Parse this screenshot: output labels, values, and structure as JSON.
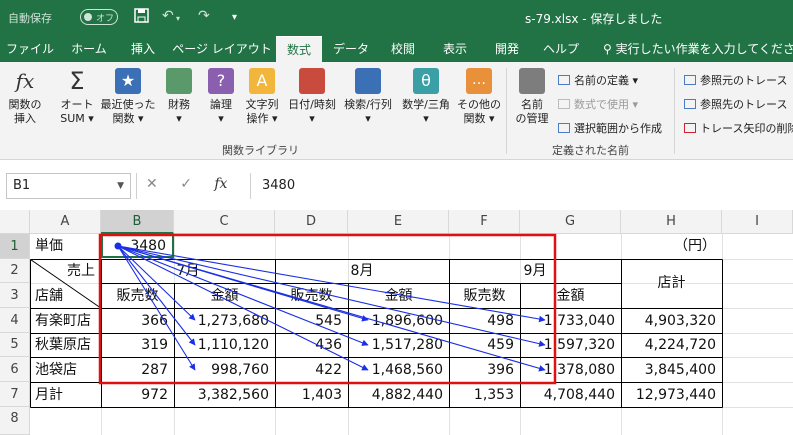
{
  "app": {
    "autosave_label": "自動保存",
    "autosave_state": "オフ",
    "title": "s-79.xlsx - 保存しました",
    "tell_me": "実行したい作業を入力してください"
  },
  "tabs": [
    "ファイル",
    "ホーム",
    "挿入",
    "ページ レイアウト",
    "数式",
    "データ",
    "校閲",
    "表示",
    "開発",
    "ヘルプ"
  ],
  "active_tab": "数式",
  "ribbon": {
    "insert_function": [
      "関数の",
      "挿入"
    ],
    "autosum": [
      "オート",
      "SUM ▾"
    ],
    "recent": [
      "最近使った",
      "関数 ▾"
    ],
    "financial": [
      "財務",
      "▾"
    ],
    "logical": [
      "論理",
      "▾"
    ],
    "text": [
      "文字列",
      "操作 ▾"
    ],
    "datetime": [
      "日付/時刻",
      "▾"
    ],
    "lookup": [
      "検索/行列",
      "▾"
    ],
    "math": [
      "数学/三角",
      "▾"
    ],
    "more": [
      "その他の",
      "関数 ▾"
    ],
    "group_library": "関数ライブラリ",
    "name_manager": [
      "名前",
      "の管理"
    ],
    "define_name": "名前の定義 ▾",
    "use_in_formula": "数式で使用 ▾",
    "create_from_selection": "選択範囲から作成",
    "group_defined": "定義された名前",
    "trace_precedents": "参照元のトレース",
    "trace_dependents": "参照先のトレース",
    "remove_arrows": "トレース矢印の削除 ▾"
  },
  "formula_bar": {
    "name_box": "B1",
    "value": "3480",
    "fx": "fx"
  },
  "columns": [
    "A",
    "B",
    "C",
    "D",
    "E",
    "F",
    "G",
    "H",
    "I"
  ],
  "rows": [
    "1",
    "2",
    "3",
    "4",
    "5",
    "6",
    "7",
    "8"
  ],
  "sheet": {
    "unit_label": "単価",
    "unit_price": "3480",
    "yen_note": "（円）",
    "diag_top": "売上",
    "diag_bottom": "店舗",
    "month_7": "7月",
    "month_8": "8月",
    "month_9": "9月",
    "total_label": "店計",
    "sub_headers": [
      "販売数",
      "金額",
      "販売数",
      "金額",
      "販売数",
      "金額"
    ],
    "data_rows": [
      [
        "有楽町店",
        "366",
        "1,273,680",
        "545",
        "1,896,600",
        "498",
        "1,733,040",
        "4,903,320"
      ],
      [
        "秋葉原店",
        "319",
        "1,110,120",
        "436",
        "1,517,280",
        "459",
        "1,597,320",
        "4,224,720"
      ],
      [
        "池袋店",
        "287",
        "998,760",
        "422",
        "1,468,560",
        "396",
        "1,378,080",
        "3,845,400"
      ],
      [
        "月計",
        "972",
        "3,382,560",
        "1,403",
        "4,882,440",
        "1,353",
        "4,708,440",
        "12,973,440"
      ]
    ]
  },
  "colors": {
    "excel_green": "#217346",
    "trace_arrow": "#1a2fe6",
    "highlight_box": "#e01010"
  }
}
